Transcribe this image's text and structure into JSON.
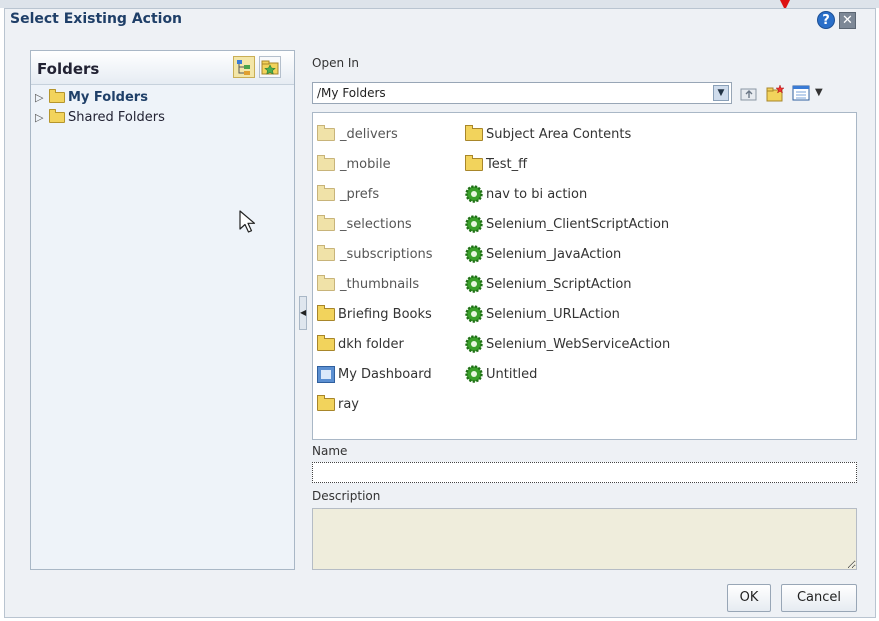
{
  "dialog": {
    "title": "Select Existing Action",
    "help_glyph": "?",
    "close_glyph": "✕"
  },
  "folders_panel": {
    "title": "Folders",
    "tree": [
      {
        "label": "My Folders",
        "selected": true
      },
      {
        "label": "Shared Folders",
        "selected": false
      }
    ]
  },
  "open_in": {
    "label": "Open In",
    "path": "/My Folders"
  },
  "files": {
    "column1": [
      {
        "name": "_delivers",
        "icon": "folder-faded-icon"
      },
      {
        "name": "_mobile",
        "icon": "folder-faded-icon"
      },
      {
        "name": "_prefs",
        "icon": "folder-faded-icon"
      },
      {
        "name": "_selections",
        "icon": "folder-faded-icon"
      },
      {
        "name": "_subscriptions",
        "icon": "folder-faded-icon"
      },
      {
        "name": "_thumbnails",
        "icon": "folder-faded-icon"
      },
      {
        "name": "Briefing Books",
        "icon": "folder-icon"
      },
      {
        "name": "dkh folder",
        "icon": "folder-icon"
      },
      {
        "name": "My Dashboard",
        "icon": "dashboard-icon"
      },
      {
        "name": "ray",
        "icon": "folder-icon"
      }
    ],
    "column2": [
      {
        "name": "Subject Area Contents",
        "icon": "folder-icon"
      },
      {
        "name": "Test_ff",
        "icon": "folder-icon"
      },
      {
        "name": "nav to bi action",
        "icon": "action-gear-icon"
      },
      {
        "name": "Selenium_ClientScriptAction",
        "icon": "action-gear-icon"
      },
      {
        "name": "Selenium_JavaAction",
        "icon": "action-gear-icon"
      },
      {
        "name": "Selenium_ScriptAction",
        "icon": "action-gear-icon"
      },
      {
        "name": "Selenium_URLAction",
        "icon": "action-gear-icon"
      },
      {
        "name": "Selenium_WebServiceAction",
        "icon": "action-gear-icon"
      },
      {
        "name": "Untitled",
        "icon": "action-gear-icon"
      }
    ]
  },
  "form": {
    "name_label": "Name",
    "name_value": "",
    "description_label": "Description",
    "description_value": ""
  },
  "buttons": {
    "ok": "OK",
    "cancel": "Cancel"
  },
  "colors": {
    "title_blue": "#1f3f68",
    "folder_yellow": "#f2d35c",
    "action_green": "#3aa02a",
    "description_bg": "#efeddc"
  }
}
